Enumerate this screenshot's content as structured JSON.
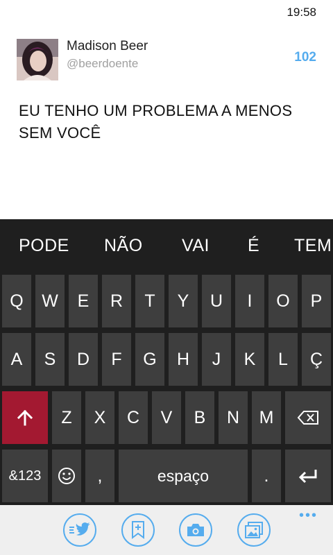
{
  "status_bar": {
    "time": "19:58"
  },
  "compose": {
    "user_name": "Madison Beer",
    "user_handle": "@beerdoente",
    "char_count": "102",
    "tweet_text": "EU TENHO UM PROBLEMA A MENOS SEM VOCÊ"
  },
  "suggestions": [
    "PODE",
    "NÃO",
    "VAI",
    "É",
    "TEM"
  ],
  "keyboard": {
    "row1": [
      "Q",
      "W",
      "E",
      "R",
      "T",
      "Y",
      "U",
      "I",
      "O",
      "P"
    ],
    "row2": [
      "A",
      "S",
      "D",
      "F",
      "G",
      "H",
      "J",
      "K",
      "L",
      "Ç"
    ],
    "row3": [
      "Z",
      "X",
      "C",
      "V",
      "B",
      "N",
      "M"
    ],
    "numbers_label": "&123",
    "comma_label": ",",
    "space_label": "espaço",
    "period_label": "."
  },
  "app_bar": {
    "buttons": [
      "tweet-icon",
      "add-bookmark-icon",
      "camera-icon",
      "image-gallery-icon"
    ],
    "more_label": "•••"
  },
  "colors": {
    "accent": "#55acee",
    "shift_key": "#a31931",
    "key_bg": "#3e3e3e",
    "keyboard_bg": "#1f1f1f"
  }
}
